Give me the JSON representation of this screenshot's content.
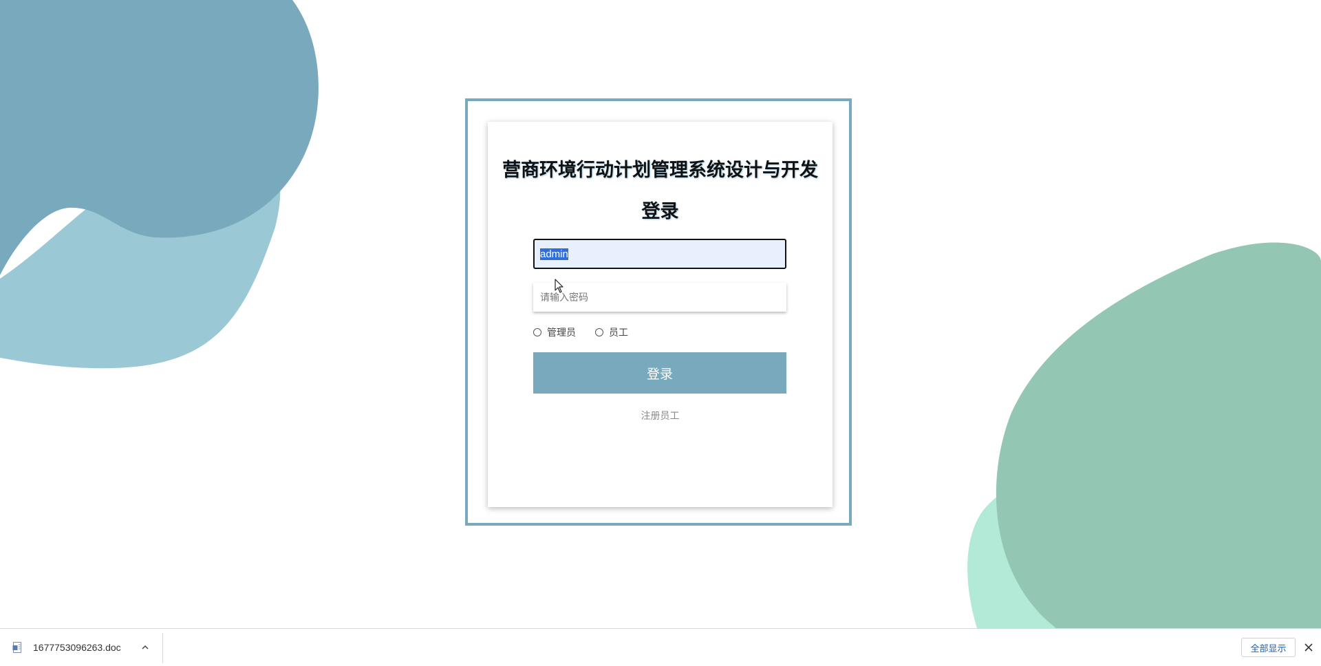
{
  "login": {
    "system_title": "营商环境行动计划管理系统设计与开发",
    "heading": "登录",
    "username_value": "admin",
    "password_placeholder": "请输入密码",
    "roles": [
      {
        "label": "管理员",
        "selected": false
      },
      {
        "label": "员工",
        "selected": false
      }
    ],
    "submit_label": "登录",
    "register_link": "注册员工"
  },
  "download_bar": {
    "file_name": "1677753096263.doc",
    "show_all_label": "全部显示"
  },
  "colors": {
    "accent": "#79a9bd",
    "blob_blue_dark": "#79a9bd",
    "blob_blue_light": "#9bc8d5",
    "blob_green_dark": "#94c6b4",
    "blob_green_light": "#b2ead7"
  },
  "icons": {
    "file": "doc-file-icon",
    "chevron": "chevron-up-icon",
    "close": "close-icon",
    "cursor": "mouse-pointer-icon"
  }
}
